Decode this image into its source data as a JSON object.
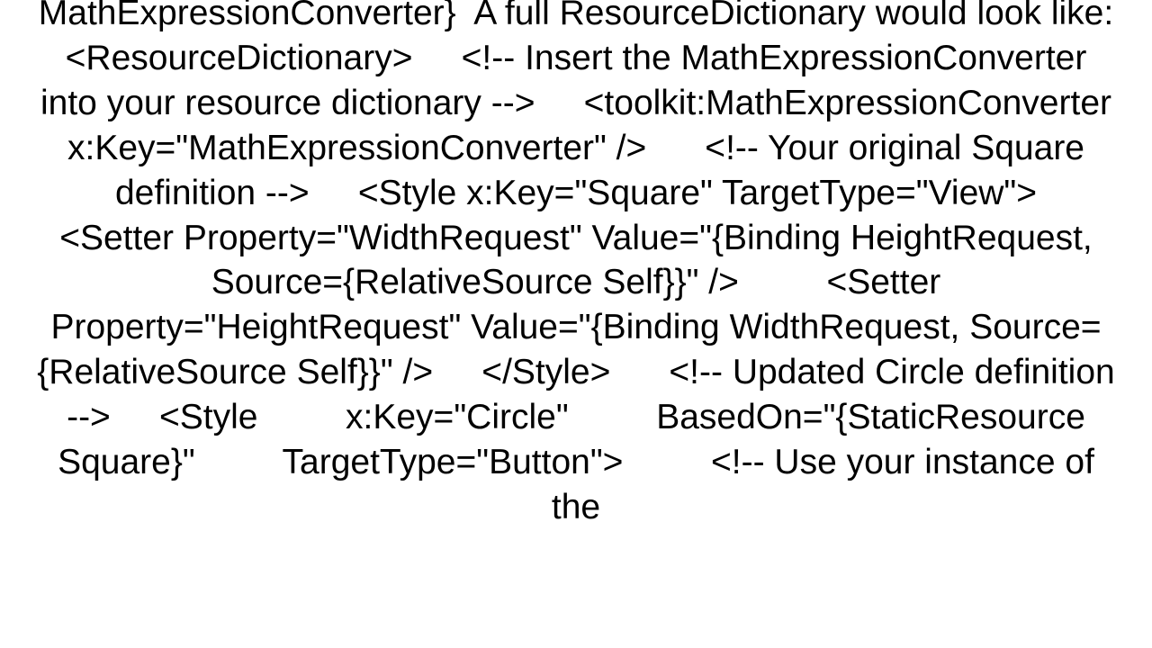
{
  "document": {
    "text": "MathExpressionConverter}  A full ResourceDictionary would look like: <ResourceDictionary>     <!-- Insert the MathExpressionConverter into your resource dictionary -->     <toolkit:MathExpressionConverter x:Key=\"MathExpressionConverter\" />      <!-- Your original Square definition -->     <Style x:Key=\"Square\" TargetType=\"View\">         <Setter Property=\"WidthRequest\" Value=\"{Binding HeightRequest, Source={RelativeSource Self}}\" />         <Setter Property=\"HeightRequest\" Value=\"{Binding WidthRequest, Source={RelativeSource Self}}\" />     </Style>      <!-- Updated Circle definition -->     <Style         x:Key=\"Circle\"         BasedOn=\"{StaticResource Square}\"         TargetType=\"Button\">         <!-- Use your instance of the"
  }
}
